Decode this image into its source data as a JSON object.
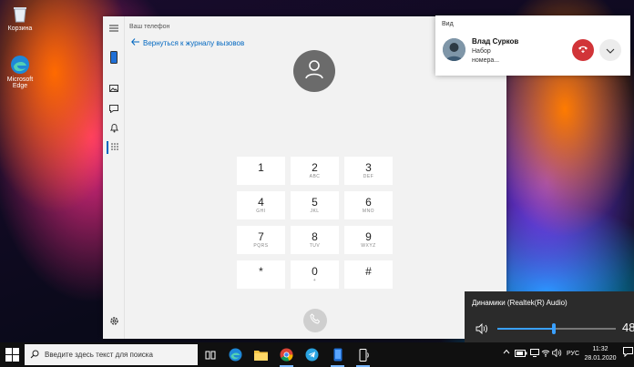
{
  "desktop": {
    "icons": [
      {
        "label": "Корзина",
        "icon": "recycle-bin-icon"
      },
      {
        "label": "Microsoft Edge",
        "icon": "edge-icon"
      }
    ]
  },
  "app": {
    "title": "Ваш телефон",
    "back_link": "Вернуться к журналу вызовов",
    "keypad": [
      {
        "digit": "1",
        "letters": ""
      },
      {
        "digit": "2",
        "letters": "ABC"
      },
      {
        "digit": "3",
        "letters": "DEF"
      },
      {
        "digit": "4",
        "letters": "GHI"
      },
      {
        "digit": "5",
        "letters": "JKL"
      },
      {
        "digit": "6",
        "letters": "MNO"
      },
      {
        "digit": "7",
        "letters": "PQRS"
      },
      {
        "digit": "8",
        "letters": "TUV"
      },
      {
        "digit": "9",
        "letters": "WXYZ"
      },
      {
        "digit": "*",
        "letters": ""
      },
      {
        "digit": "0",
        "letters": "+"
      },
      {
        "digit": "#",
        "letters": ""
      }
    ]
  },
  "notification": {
    "app_name": "Вид",
    "caller_name": "Влад Сурков",
    "status_line1": "Набор",
    "status_line2": "номера..."
  },
  "volume": {
    "device": "Динамики (Realtek(R) Audio)",
    "level": 48,
    "level_text": "48"
  },
  "taskbar": {
    "search_placeholder": "Введите здесь текст для поиска",
    "language": "РУС",
    "time": "11:32",
    "date": "28.01.2020"
  },
  "colors": {
    "accent": "#0067c0",
    "hangup": "#d13438",
    "volume_accent": "#3aa0ff"
  }
}
